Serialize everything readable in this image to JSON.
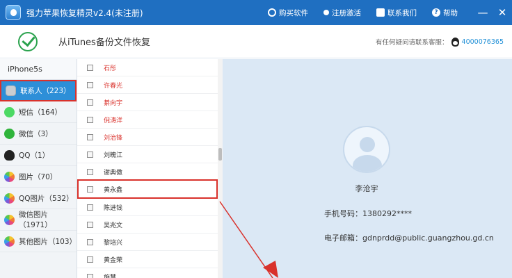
{
  "title_bar": {
    "app_title": "强力苹果恢复精灵v2.4(未注册)",
    "actions": {
      "buy": "购买软件",
      "register": "注册激活",
      "contact": "联系我们",
      "help": "帮助"
    },
    "minimize": "—",
    "close": "✕",
    "color": "#1f6fc1"
  },
  "header": {
    "title": "从iTunes备份文件恢复",
    "service_label": "有任何疑问请联系客服：",
    "service_number": "4000076365"
  },
  "sidebar": {
    "device": "iPhone5s",
    "items": [
      {
        "label": "联系人（223）",
        "icon": "contacts-icon",
        "active": true
      },
      {
        "label": "短信（164）",
        "icon": "sms-icon"
      },
      {
        "label": "微信（3）",
        "icon": "wechat-icon"
      },
      {
        "label": "QQ（1）",
        "icon": "qq-icon"
      },
      {
        "label": "图片（70）",
        "icon": "photos-icon"
      },
      {
        "label": "QQ图片（532）",
        "icon": "qq-photos-icon"
      },
      {
        "label": "微信图片（1971）",
        "icon": "wechat-photos-icon"
      },
      {
        "label": "其他图片（103）",
        "icon": "other-photos-icon"
      }
    ]
  },
  "contacts": [
    {
      "name": "石彤",
      "deleted": true
    },
    {
      "name": "许春光",
      "deleted": true
    },
    {
      "name": "綦向宇",
      "deleted": true
    },
    {
      "name": "倪涛洋",
      "deleted": true
    },
    {
      "name": "刘治锋",
      "deleted": true
    },
    {
      "name": "刘魄江",
      "deleted": false
    },
    {
      "name": "谢典傲",
      "deleted": false
    },
    {
      "name": "黄永鑫",
      "deleted": false,
      "highlighted": true
    },
    {
      "name": "陈进钱",
      "deleted": false
    },
    {
      "name": "吴兆文",
      "deleted": false
    },
    {
      "name": "黎培兴",
      "deleted": false
    },
    {
      "name": "黄金荣",
      "deleted": false
    },
    {
      "name": "施慧",
      "deleted": false
    }
  ],
  "detail": {
    "name": "李沧宇",
    "phone_label": "手机号码：",
    "phone": "1380292****",
    "email_label": "电子邮箱：",
    "email": "gdnprdd@public.guangzhou.gd.cn"
  },
  "colors": {
    "accent": "#2d8fd8",
    "highlight_border": "#d9312b",
    "deleted_text": "#d9312b",
    "detail_bg": "#dbe8f5"
  }
}
